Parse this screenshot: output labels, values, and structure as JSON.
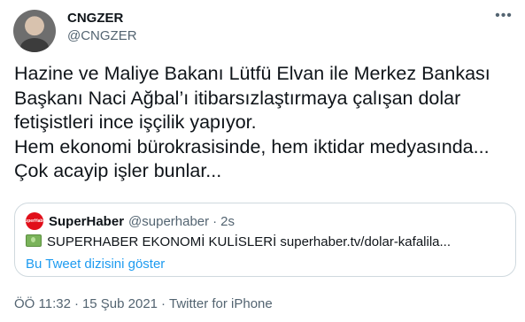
{
  "tweet": {
    "author_name": "CNGZER",
    "author_handle": "@CNGZER",
    "more_icon": "more-icon",
    "text": "Hazine ve Maliye Bakanı Lütfü Elvan ile Merkez Bankası\nBaşkanı Naci Ağbal’ı itibarsızlaştırmaya çalışan dolar\nfetişistleri ince işçilik yapıyor.\nHem ekonomi bürokrasisinde, hem iktidar medyasında...\nÇok acayip işler bunlar...",
    "time": "ÖÖ 11:32",
    "date": "15 Şub 2021",
    "source": "Twitter for iPhone",
    "separator": "·"
  },
  "quote": {
    "avatar_label": "SuperHaber",
    "author_name": "SuperHaber",
    "author_handle": "@superhaber",
    "age": "2s",
    "separator": "·",
    "emoji_icon": "money-icon",
    "text": "SUPERHABER EKONOMİ KULİSLERİ superhaber.tv/dolar-kafalila...",
    "thread_link": "Bu Tweet dizisini göster"
  },
  "colors": {
    "text": "#0f1419",
    "secondary": "#536471",
    "link": "#1d9bf0",
    "border": "#cfd9de",
    "brand_red": "#e10f1a"
  }
}
